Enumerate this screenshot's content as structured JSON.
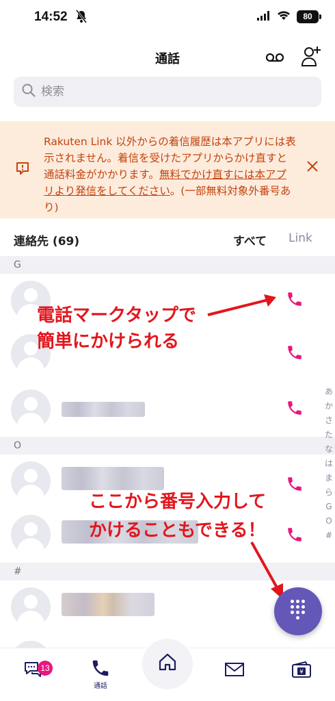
{
  "status_bar": {
    "time": "14:52",
    "battery": "80"
  },
  "header": {
    "title": "通話"
  },
  "search": {
    "placeholder": "検索"
  },
  "notice": {
    "text_part1": "Rakuten Link 以外からの着信履歴は本アプリには表示されません。着信を受けたアプリからかけ直すと通話料金がかかります。",
    "text_link": "無料でかけ直すには本アプリより発信をしてください",
    "text_part2": "。(一部無料対象外番号あり)"
  },
  "contacts": {
    "title": "連絡先 (69)",
    "tab_all": "すべて",
    "tab_link": "Link"
  },
  "sections": [
    "G",
    "O",
    "#"
  ],
  "annotations": {
    "tap_phone_line1": "電話マークタップで",
    "tap_phone_line2": "簡単にかけられる",
    "dial_line1": "ここから番号入力して",
    "dial_line2": "かけることもできる！"
  },
  "index_bar": [
    "あ",
    "か",
    "さ",
    "た",
    "な",
    "は",
    "ま",
    "ら",
    "G",
    "O",
    "#"
  ],
  "tabbar": {
    "calls_label": "通話",
    "unread_badge": "13"
  },
  "colors": {
    "accent": "#6357b8",
    "phone": "#e8177d",
    "annotation": "#e2161d",
    "notice_bg": "#fdebdc",
    "notice_text": "#c1440e"
  }
}
